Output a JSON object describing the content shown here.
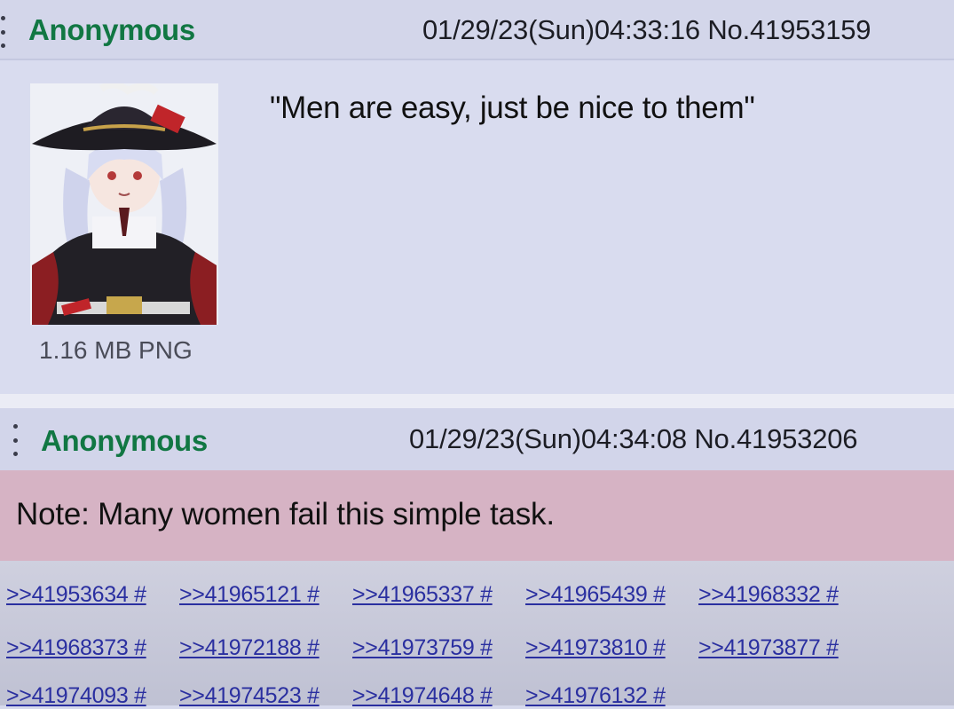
{
  "posts": [
    {
      "name": "Anonymous",
      "datetime": "01/29/23(Sun)04:33:16",
      "number": "No.41953159",
      "file_info": "1.16 MB PNG",
      "comment": "\"Men are easy, just be nice to them\""
    },
    {
      "name": "Anonymous",
      "datetime": "01/29/23(Sun)04:34:08",
      "number": "No.41953206",
      "comment": "Note: Many women fail this simple task."
    }
  ],
  "replies": [
    [
      ">>41953634 #",
      ">>41965121 #",
      ">>41965337 #",
      ">>41965439 #",
      ">>41968332 #"
    ],
    [
      ">>41968373 #",
      ">>41972188 #",
      ">>41973759 #",
      ">>41973810 #",
      ">>41973877 #"
    ],
    [
      ">>41974093 #",
      ">>41974523 #",
      ">>41974648 #",
      ">>41976132 #"
    ]
  ],
  "colors": {
    "name_green": "#117743",
    "link_blue": "#2a2fa0",
    "quote_band": "#d6b3c4"
  }
}
